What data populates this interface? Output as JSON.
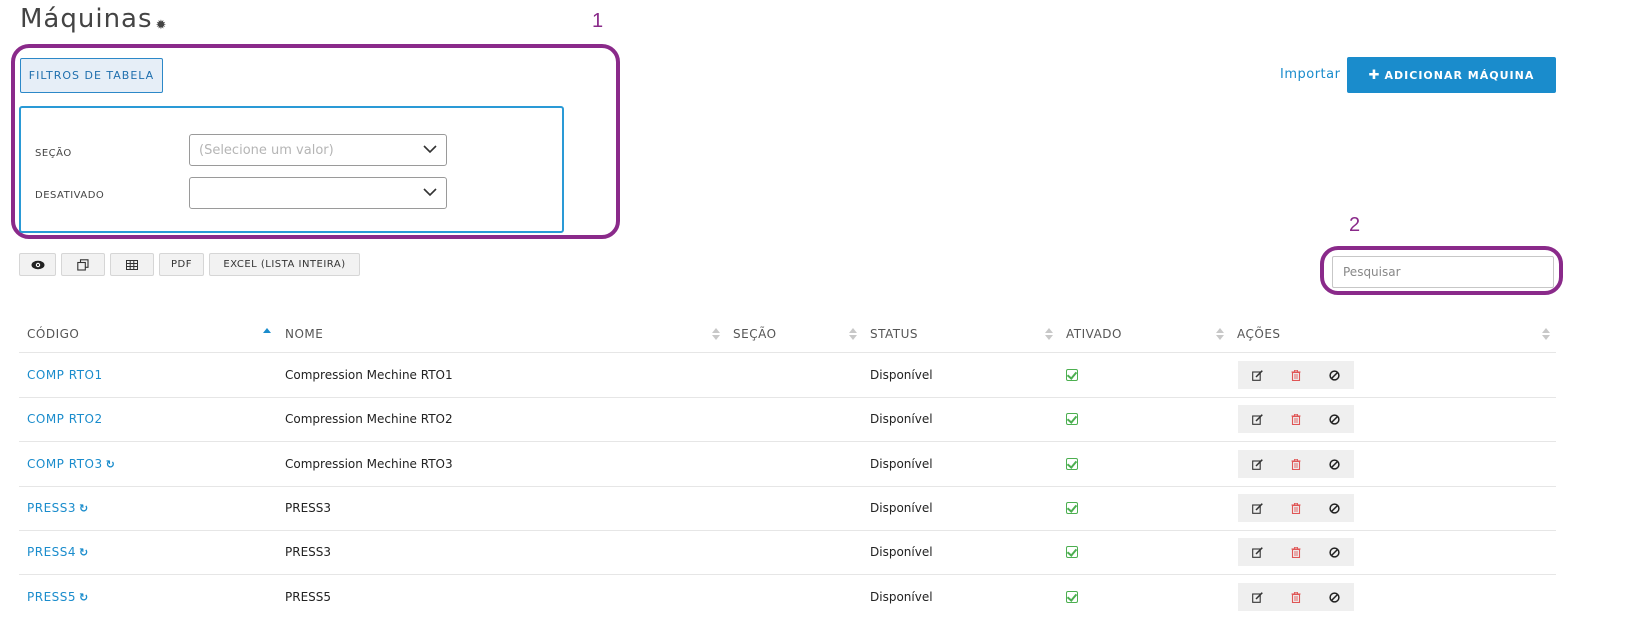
{
  "page": {
    "title": "Máquinas"
  },
  "filters": {
    "toggle_label": "FILTROS DE TABELA",
    "fields": [
      {
        "label": "SEÇÃO",
        "value": "",
        "placeholder": "(Selecione um valor)"
      },
      {
        "label": "DESATIVADO",
        "value": "",
        "placeholder": ""
      }
    ]
  },
  "header_actions": {
    "import_label": "Importar",
    "add_label": "ADICIONAR MÁQUINA"
  },
  "toolbar": {
    "pdf_label": "PDF",
    "excel_label": "EXCEL (LISTA INTEIRA)"
  },
  "search": {
    "placeholder": "Pesquisar",
    "value": ""
  },
  "annotations": [
    "1",
    "2"
  ],
  "table": {
    "columns": [
      "CÓDIGO",
      "NOME",
      "SEÇÃO",
      "STATUS",
      "ATIVADO",
      "AÇÕES"
    ],
    "sorted_column": "CÓDIGO",
    "sort_direction": "ascending",
    "rows": [
      {
        "code": "COMP RTO1",
        "synced": false,
        "name": "Compression Mechine RTO1",
        "section": "",
        "status": "Disponível",
        "active": true
      },
      {
        "code": "COMP RTO2",
        "synced": false,
        "name": "Compression Mechine RTO2",
        "section": "",
        "status": "Disponível",
        "active": true
      },
      {
        "code": "COMP RTO3",
        "synced": true,
        "name": "Compression Mechine RTO3",
        "section": "",
        "status": "Disponível",
        "active": true
      },
      {
        "code": "PRESS3",
        "synced": true,
        "name": "PRESS3",
        "section": "",
        "status": "Disponível",
        "active": true
      },
      {
        "code": "PRESS4",
        "synced": true,
        "name": "PRESS3",
        "section": "",
        "status": "Disponível",
        "active": true
      },
      {
        "code": "PRESS5",
        "synced": true,
        "name": "PRESS5",
        "section": "",
        "status": "Disponível",
        "active": true
      }
    ]
  },
  "icons": {
    "title_gear": "gear-icon",
    "toolbar": [
      "eye-icon",
      "copy-icon",
      "table-icon"
    ],
    "row_actions": [
      "edit-icon",
      "trash-icon",
      "ban-icon"
    ],
    "sync": "refresh-icon",
    "active": "check-square-icon"
  },
  "colors": {
    "accent": "#1a8ccc",
    "annotation": "#8a2a8a",
    "check": "#4caf50",
    "delete": "#e05555"
  }
}
